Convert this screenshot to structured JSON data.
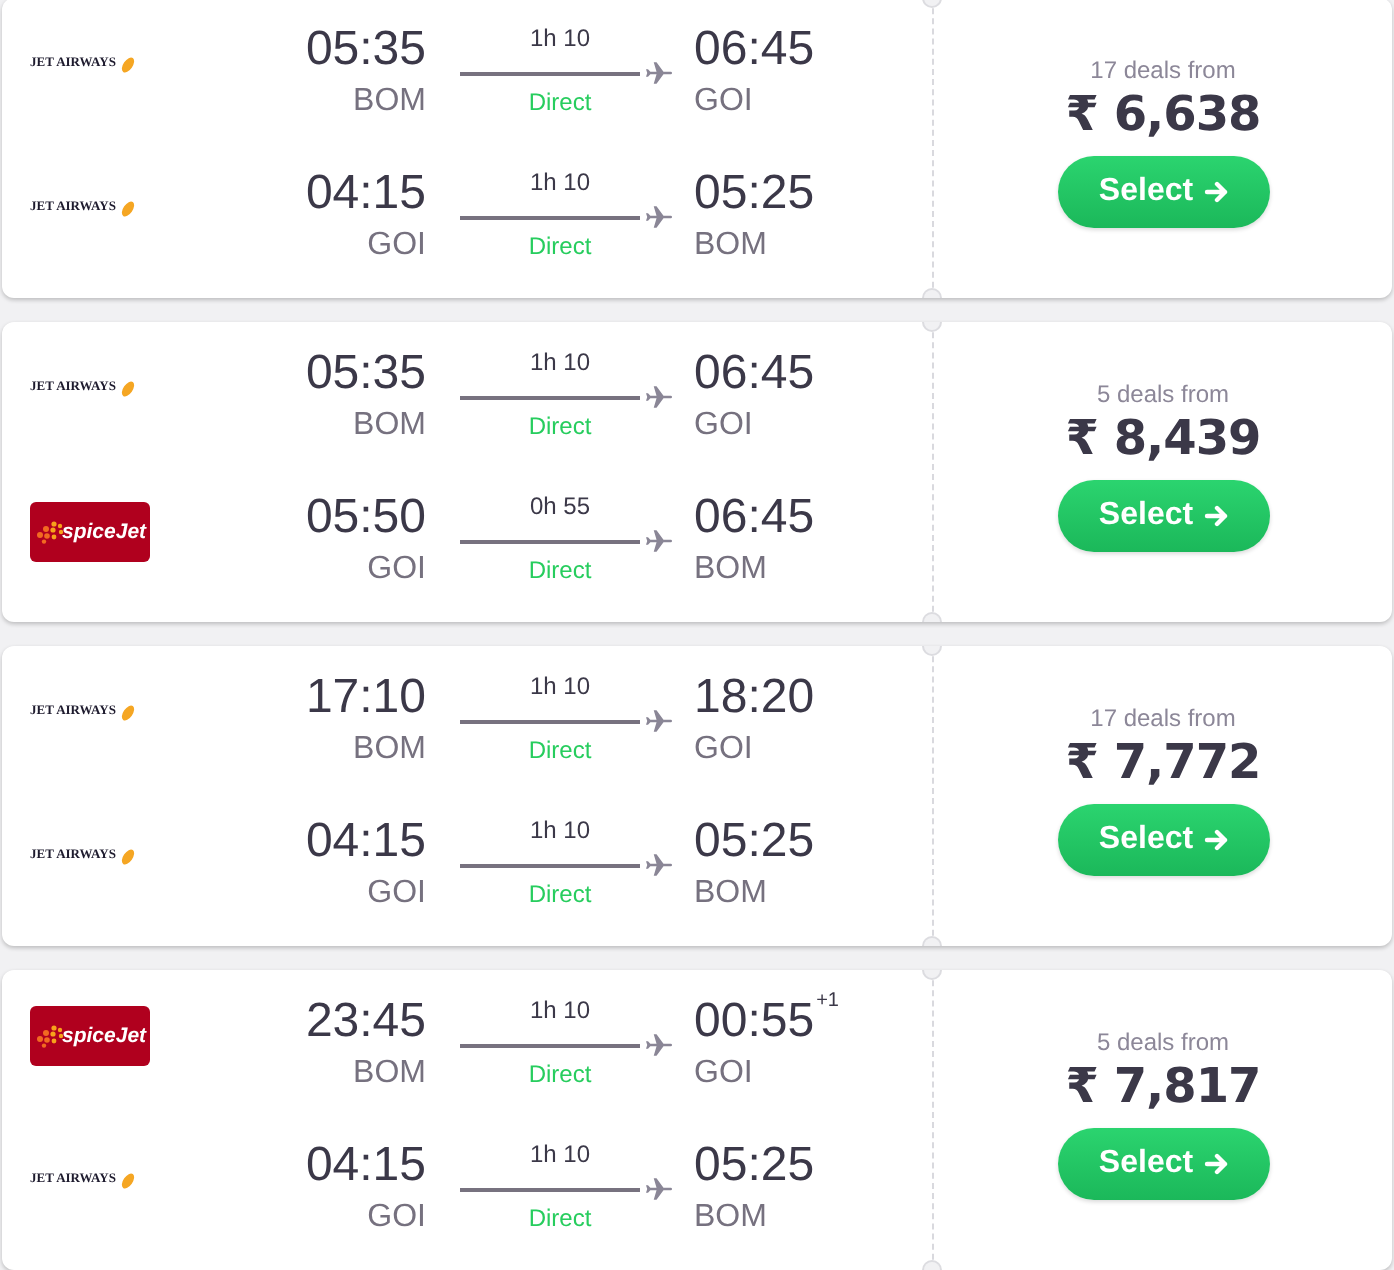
{
  "cards": [
    {
      "legs": [
        {
          "airline": {
            "kind": "wordmark",
            "logo_text": "JET AIRWAYS"
          },
          "departure_time": "05:35",
          "departure_airport": "BOM",
          "duration": "1h 10",
          "stops": "Direct",
          "arrival_time": "06:45",
          "arrival_airport": "GOI"
        },
        {
          "airline": {
            "kind": "wordmark",
            "logo_text": "JET AIRWAYS"
          },
          "departure_time": "04:15",
          "departure_airport": "GOI",
          "duration": "1h 10",
          "stops": "Direct",
          "arrival_time": "05:25",
          "arrival_airport": "BOM"
        }
      ],
      "deals": "17 deals from",
      "price": "₹ 6,638",
      "button": "Select"
    },
    {
      "legs": [
        {
          "airline": {
            "kind": "wordmark",
            "logo_text": "JET AIRWAYS"
          },
          "departure_time": "05:35",
          "departure_airport": "BOM",
          "duration": "1h 10",
          "stops": "Direct",
          "arrival_time": "06:45",
          "arrival_airport": "GOI"
        },
        {
          "airline": {
            "kind": "tile",
            "logo_text": "spiceJet"
          },
          "departure_time": "05:50",
          "departure_airport": "GOI",
          "duration": "0h 55",
          "stops": "Direct",
          "arrival_time": "06:45",
          "arrival_airport": "BOM"
        }
      ],
      "deals": "5 deals from",
      "price": "₹ 8,439",
      "button": "Select"
    },
    {
      "legs": [
        {
          "airline": {
            "kind": "wordmark",
            "logo_text": "JET AIRWAYS"
          },
          "departure_time": "17:10",
          "departure_airport": "BOM",
          "duration": "1h 10",
          "stops": "Direct",
          "arrival_time": "18:20",
          "arrival_airport": "GOI"
        },
        {
          "airline": {
            "kind": "wordmark",
            "logo_text": "JET AIRWAYS"
          },
          "departure_time": "04:15",
          "departure_airport": "GOI",
          "duration": "1h 10",
          "stops": "Direct",
          "arrival_time": "05:25",
          "arrival_airport": "BOM"
        }
      ],
      "deals": "17 deals from",
      "price": "₹ 7,772",
      "button": "Select"
    },
    {
      "legs": [
        {
          "airline": {
            "kind": "tile",
            "logo_text": "spiceJet"
          },
          "departure_time": "23:45",
          "departure_airport": "BOM",
          "duration": "1h 10",
          "stops": "Direct",
          "arrival_time": "00:55",
          "arrival_day_offset": "+1",
          "arrival_airport": "GOI"
        },
        {
          "airline": {
            "kind": "wordmark",
            "logo_text": "JET AIRWAYS"
          },
          "departure_time": "04:15",
          "departure_airport": "GOI",
          "duration": "1h 10",
          "stops": "Direct",
          "arrival_time": "05:25",
          "arrival_airport": "BOM"
        }
      ],
      "deals": "5 deals from",
      "price": "₹ 7,817",
      "button": "Select"
    }
  ]
}
